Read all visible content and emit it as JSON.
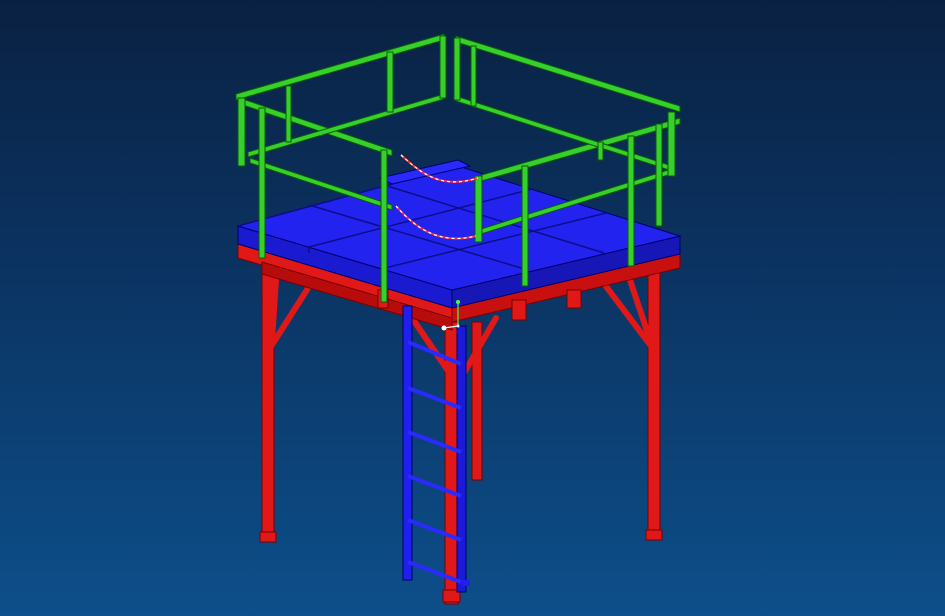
{
  "viewport": {
    "background_top": "#0a2142",
    "background_bottom": "#0d4f8a"
  },
  "model": {
    "colors": {
      "columns_and_beams": "#e01818",
      "deck_and_ladder": "#1f1fee",
      "handrail": "#35d02c",
      "cable_path": "#ff3030",
      "origin_marker": "#ffffff"
    },
    "parts": {
      "columns": 4,
      "knee_braces": 6,
      "deck_plates": 9,
      "handrail_posts": 10,
      "ladder_rungs": 8
    },
    "icons": [
      "coordinate-triad-icon"
    ]
  }
}
